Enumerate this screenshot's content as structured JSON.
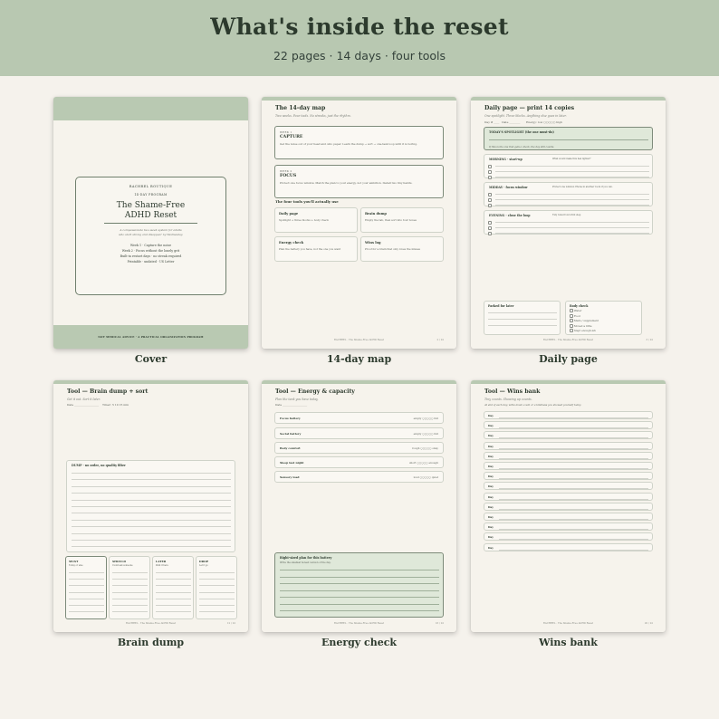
{
  "header": {
    "title": "What's inside the reset",
    "subtitle": "22 pages  ·  14 days  ·  four tools"
  },
  "cards": {
    "cover": {
      "caption": "Cover",
      "brand": "RACHREL BOUTIQUE",
      "program": "14-DAY PROGRAM",
      "title_line1": "The Shame-Free",
      "title_line2": "ADHD Reset",
      "desc_line1": "A compassionate two-week system for adults",
      "desc_line2": "who start strong and disappear by Wednesday.",
      "week1": "Week 1 · Capture the noise",
      "week2": "Week 2 · Focus without the lonely grit",
      "rest": "Built-in restart days · no streak required",
      "printable": "Printable · undated · US Letter",
      "footer": "NOT MEDICAL ADVICE · A PRACTICAL ORGANIZATION PROGRAM"
    },
    "map": {
      "caption": "14-day map",
      "title": "The 14-day map",
      "subtitle": "Two weeks. Four tools. No streaks, just the rhythm.",
      "week1_tag": "WEEK 1",
      "week1_name": "CAPTURE",
      "week1_desc": "Get the noise out of your head and onto paper. Learn the dump → sort → one-task loop until it is boring.",
      "week2_tag": "WEEK 2",
      "week2_name": "FOCUS",
      "week2_desc": "Protect one focus window. Match the plan to your energy, not your ambition. Install two tiny habits.",
      "tools_heading": "The four tools you'll actually use",
      "tools": [
        {
          "name": "Daily page",
          "desc": "Spotlight + three blocks + body check"
        },
        {
          "name": "Brain dump",
          "desc": "Empty the tab, then sort into four boxes"
        },
        {
          "name": "Energy check",
          "desc": "Plan the battery you have, not the one you want"
        },
        {
          "name": "Wins log",
          "desc": "Proof for a brain that only loves the misses"
        }
      ],
      "footer": "RACHREL · The Shame-Free ADHD Reset",
      "page": "2 / 22"
    },
    "daily": {
      "caption": "Daily page",
      "title": "Daily page — print 14 copies",
      "subtitle": "One spotlight. Three blocks. Anything else goes in later.",
      "day_label": "Day #",
      "date_label": "Date",
      "energy_label": "Energy: low",
      "energy_high": "high",
      "spotlight": "TODAY'S SPOTLIGHT (the one must-do)",
      "spotlight_hint": "If this is the one that gets a check, the day still counts.",
      "blocks": [
        {
          "name": "MORNING · start-up",
          "hint": "What would make this feel lighter?"
        },
        {
          "name": "MIDDAY · focus window",
          "hint": "Protect one window. Phone in another room if you can."
        },
        {
          "name": "EVENING · close the loop",
          "hint": "Tidy tomorrow's first step"
        }
      ],
      "parked": "Parked for later",
      "body_check": "Body check",
      "body_items": [
        "Water",
        "Food",
        "Meds / supplement",
        "Moved a little",
        "Slept enough-ish"
      ],
      "footer": "RACHREL · The Shame-Free ADHD Reset",
      "page": "3 / 22"
    },
    "brain": {
      "caption": "Brain dump",
      "title": "Tool — Brain dump + sort",
      "subtitle": "Get it out. Sort it later.",
      "date_label": "Date",
      "timer_label": "Timer:",
      "timer_opts": "5   10   15   min",
      "dump_label": "DUMP · no order, no quality filter",
      "sort": [
        {
          "name": "MUST",
          "hint": "Today or else"
        },
        {
          "name": "SHOULD",
          "hint": "Could ask someone"
        },
        {
          "name": "LATER",
          "hint": "Park it here"
        },
        {
          "name": "DROP",
          "hint": "Let it go"
        }
      ],
      "footer": "RACHREL · The Shame-Free ADHD Reset",
      "page": "12 / 22"
    },
    "energy": {
      "caption": "Energy check",
      "title": "Tool — Energy & capacity",
      "subtitle": "Plan the tank you have today.",
      "date_label": "Date",
      "rows": [
        {
          "name": "Focus battery",
          "scale": "empty  ○○○○○  full"
        },
        {
          "name": "Social battery",
          "scale": "empty  ○○○○○  full"
        },
        {
          "name": "Body comfort",
          "scale": "rough  ○○○○○  okay"
        },
        {
          "name": "Sleep last night",
          "scale": "short  ○○○○○  enough"
        },
        {
          "name": "Sensory load",
          "scale": "loud  ○○○○○  quiet"
        }
      ],
      "plan_title": "Right-sized plan for this battery",
      "plan_hint": "Write the smallest honest version of the day.",
      "footer": "RACHREL · The Shame-Free ADHD Reset",
      "page": "16 / 22"
    },
    "wins": {
      "caption": "Wins bank",
      "title": "Tool — Wins bank",
      "subtitle": "Tiny counts. Showing up counts.",
      "hint": "At end of each day, write down a win or a kindness you showed yourself today.",
      "days": [
        "Day",
        "Day",
        "Day",
        "Day",
        "Day",
        "Day",
        "Day",
        "Day",
        "Day",
        "Day",
        "Day",
        "Day",
        "Day",
        "Day"
      ],
      "footer": "RACHREL · The Shame-Free ADHD Reset",
      "page": "20 / 22"
    }
  }
}
